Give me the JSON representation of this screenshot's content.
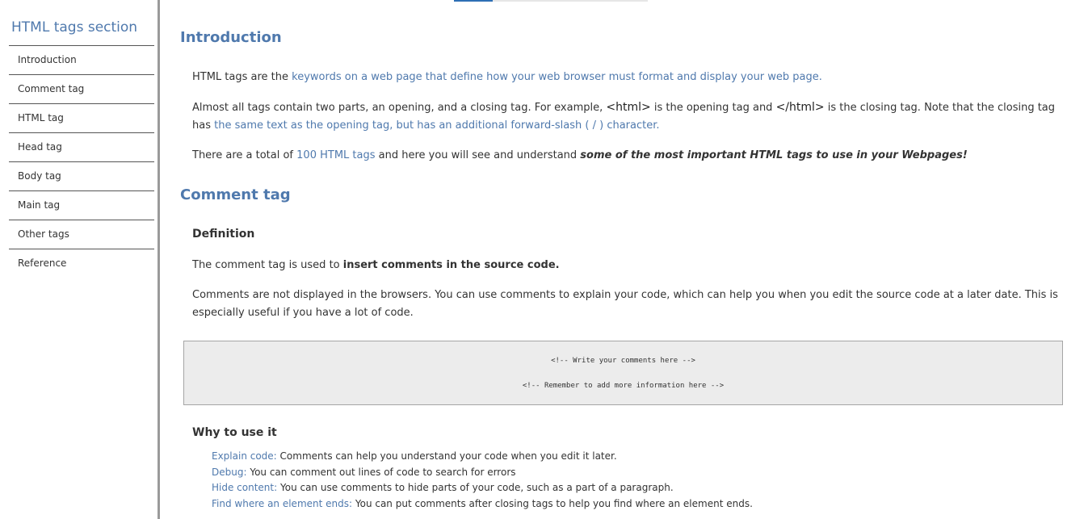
{
  "sidebar": {
    "title": "HTML tags section",
    "items": [
      {
        "label": "Introduction"
      },
      {
        "label": "Comment tag"
      },
      {
        "label": "HTML tag"
      },
      {
        "label": "Head tag"
      },
      {
        "label": "Body tag"
      },
      {
        "label": "Main tag"
      },
      {
        "label": "Other tags"
      },
      {
        "label": "Reference"
      }
    ]
  },
  "intro": {
    "title": "Introduction",
    "p1_text": "HTML tags are the ",
    "p1_link": "keywords on a web page that define how your web browser must format and display your web page.",
    "p2_text_a": "Almost all tags contain two parts, an opening, and a closing tag. For example, ",
    "p2_code_open": "<html>",
    "p2_text_b": " is the opening tag and ",
    "p2_code_close": "</html>",
    "p2_text_c": " is the closing tag. Note that the closing tag has ",
    "p2_link": "the same text as the opening tag, but has an additional forward-slash ( / ) character.",
    "p3_text_a": "There are a total of ",
    "p3_link": "100 HTML tags",
    "p3_text_b": " and here you will see and understand ",
    "p3_emphasis": "some of the most important HTML tags to use in your Webpages!"
  },
  "comment": {
    "title": "Comment tag",
    "definition_heading": "Definition",
    "p1_text": "The comment tag is used to ",
    "p1_strong": "insert comments in the source code.",
    "p2_text": "Comments are not displayed in the browsers. You can use comments to explain your code, which can help you when you edit the source code at a later date. This is especially useful if you have a lot of code.",
    "code_lines": [
      "<!-- Write your comments here -->",
      "<!-- Remember to add more information here -->"
    ],
    "why_heading": "Why to use it",
    "uses": [
      {
        "key": "Explain code:",
        "text": " Comments can help you understand your code when you edit it later."
      },
      {
        "key": "Debug:",
        "text": " You can comment out lines of code to search for errors"
      },
      {
        "key": "Hide content:",
        "text": " You can use comments to hide parts of your code, such as a part of a paragraph."
      },
      {
        "key": "Find where an element ends:",
        "text": " You can put comments after closing tags to help you find where an element ends."
      }
    ]
  },
  "colors": {
    "accent": "#4f79ad",
    "text": "#333333",
    "code_bg": "#ececec",
    "sidebar_border": "#9a9a9a"
  },
  "scroll_progress": 0.2
}
